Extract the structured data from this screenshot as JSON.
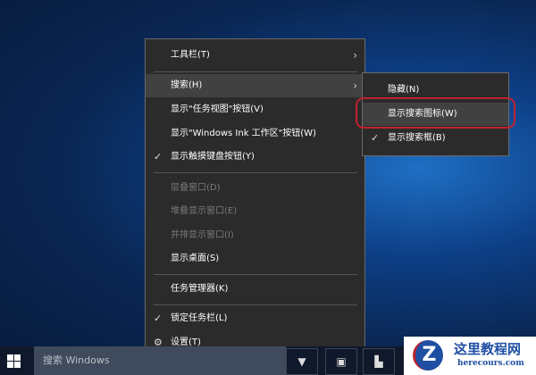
{
  "context_menu": {
    "items": [
      {
        "label": "工具栏(T)",
        "submenu": true
      },
      {
        "label": "搜索(H)",
        "submenu": true
      },
      {
        "label": "显示\"任务视图\"按钮(V)"
      },
      {
        "label": "显示\"Windows Ink 工作区\"按钮(W)"
      },
      {
        "label": "显示触摸键盘按钮(Y)",
        "checked": true
      },
      {
        "label": "层叠窗口(D)",
        "disabled": true
      },
      {
        "label": "堆叠显示窗口(E)",
        "disabled": true
      },
      {
        "label": "并排显示窗口(I)",
        "disabled": true
      },
      {
        "label": "显示桌面(S)"
      },
      {
        "label": "任务管理器(K)"
      },
      {
        "label": "锁定任务栏(L)",
        "checked": true
      },
      {
        "label": "设置(T)"
      }
    ],
    "check_glyph": "✓",
    "arrow_glyph": "›"
  },
  "search_submenu": {
    "items": [
      {
        "label": "隐藏(N)"
      },
      {
        "label": "显示搜索图标(W)"
      },
      {
        "label": "显示搜索框(B)",
        "checked": true
      }
    ]
  },
  "taskbar": {
    "search_placeholder": "搜索 Windows"
  },
  "watermark": {
    "title": "这里教程网",
    "url": "herecours.com",
    "letter": "Z"
  }
}
